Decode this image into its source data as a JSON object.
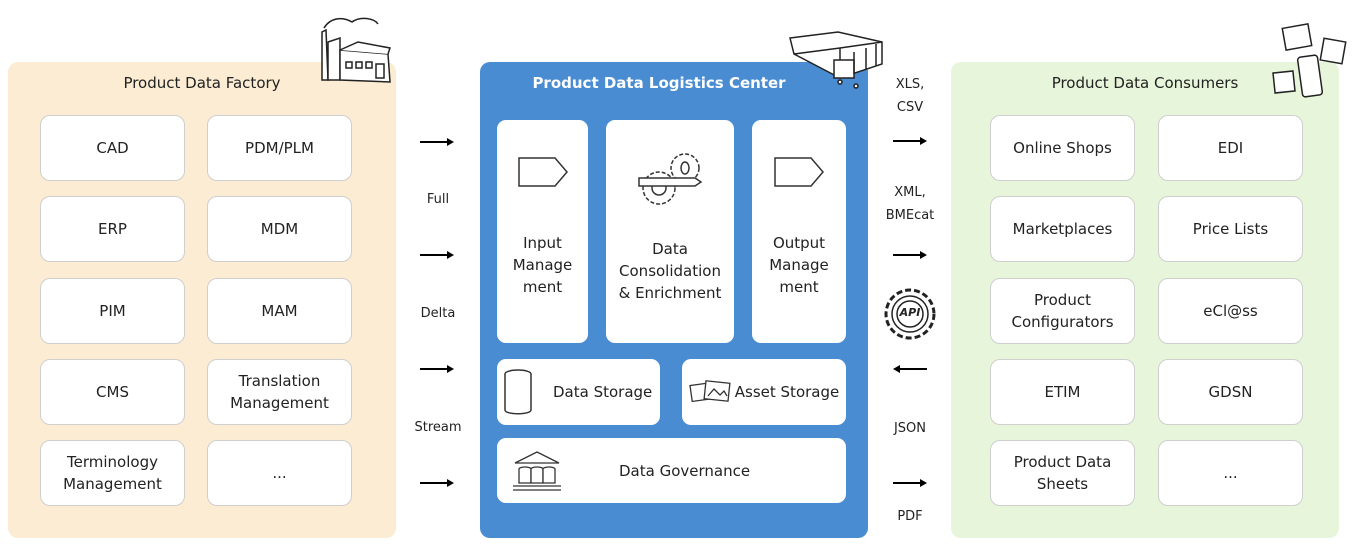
{
  "factory": {
    "title": "Product Data Factory",
    "items": [
      "CAD",
      "PDM/PLM",
      "ERP",
      "MDM",
      "PIM",
      "MAM",
      "CMS",
      "Translation Management",
      "Terminology Management",
      "..."
    ]
  },
  "center": {
    "title": "Product Data Logistics Center",
    "input": "Input Manage ment",
    "consolidation": "Data Consolidation & Enrichment",
    "output": "Output Manage ment",
    "data_storage": "Data Storage",
    "asset_storage": "Asset Storage",
    "governance": "Data Governance"
  },
  "left_flows": [
    "Full",
    "Delta",
    "Stream"
  ],
  "right_flows": {
    "xls": "XLS, CSV",
    "xml": "XML, BMEcat",
    "api": "API",
    "json": "JSON",
    "pdf": "PDF"
  },
  "consumers": {
    "title": "Product Data Consumers",
    "items": [
      "Online Shops",
      "EDI",
      "Marketplaces",
      "Price Lists",
      "Product Configurators",
      "eCl@ss",
      "ETIM",
      "GDSN",
      "Product Data Sheets",
      "..."
    ]
  },
  "colors": {
    "factory_bg": "#fbecd3",
    "center_bg": "#4a8cd2",
    "consumers_bg": "#e7f5da"
  }
}
